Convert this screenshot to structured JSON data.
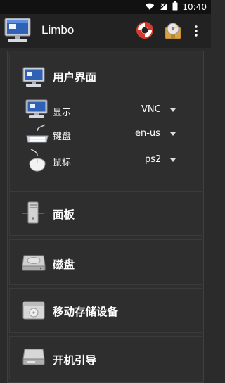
{
  "status_bar": {
    "time": "10:40"
  },
  "app_bar": {
    "title": "Limbo"
  },
  "sections": {
    "user_interface": {
      "title": "用户界面",
      "rows": [
        {
          "label": "显示",
          "value": "VNC"
        },
        {
          "label": "键盘",
          "value": "en-us"
        },
        {
          "label": "鼠标",
          "value": "ps2"
        }
      ]
    },
    "panel": {
      "title": "面板"
    },
    "disk": {
      "title": "磁盘"
    },
    "removable": {
      "title": "移动存储设备"
    },
    "boot": {
      "title": "开机引导"
    }
  }
}
